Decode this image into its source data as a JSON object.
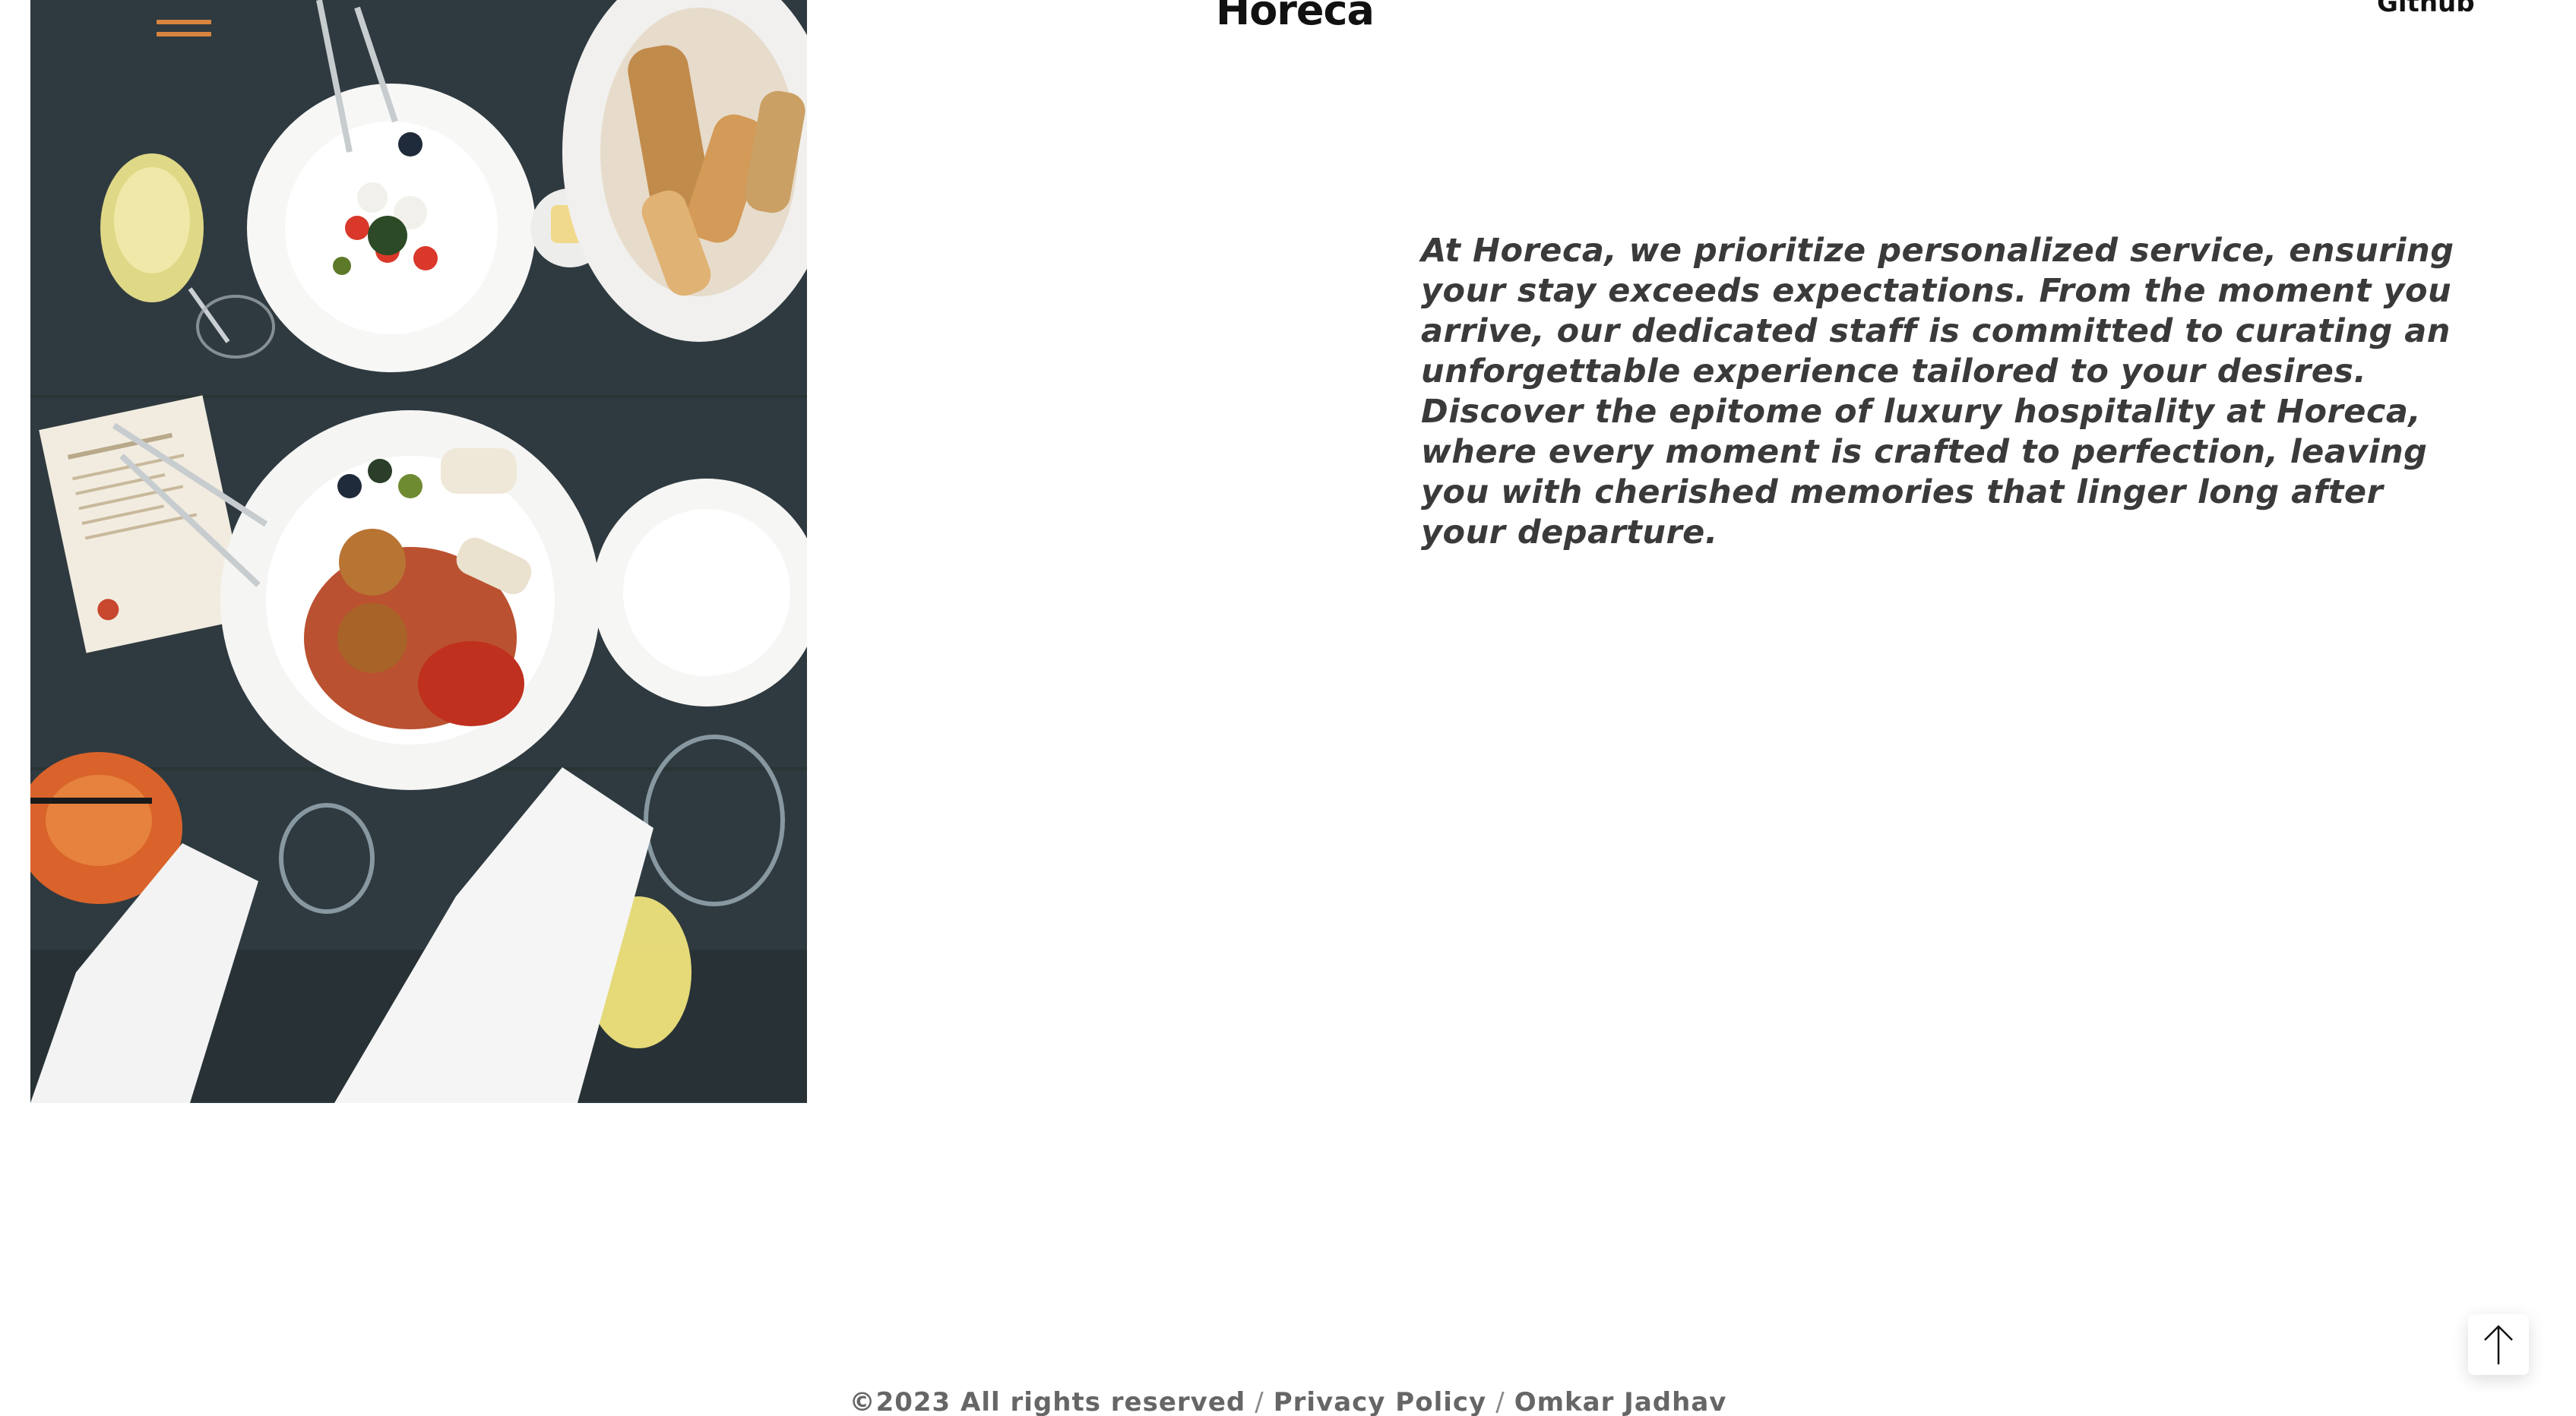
{
  "header": {
    "brand": "Horeca",
    "menu_icon": "hamburger-menu-icon",
    "github_label": "Github"
  },
  "hero": {
    "image_alt": "Restaurant table with plated dishes",
    "intro": "At Horeca, we prioritize personalized service, ensuring your stay exceeds expectations. From the moment you arrive, our dedicated staff is committed to curating an unforgettable experience tailored to your desires. Discover the epitome of luxury hospitality at Horeca, where every moment is crafted to perfection, leaving you with cherished memories that linger long after your departure."
  },
  "footer": {
    "copyright": "©2023 All rights reserved",
    "separator": "/",
    "privacy_label": "Privacy Policy",
    "author": "Omkar Jadhav"
  },
  "scroll_top": {
    "icon": "arrow-up-icon"
  },
  "colors": {
    "accent": "#d8843f",
    "text": "#3a3a3a",
    "heading": "#111111"
  }
}
